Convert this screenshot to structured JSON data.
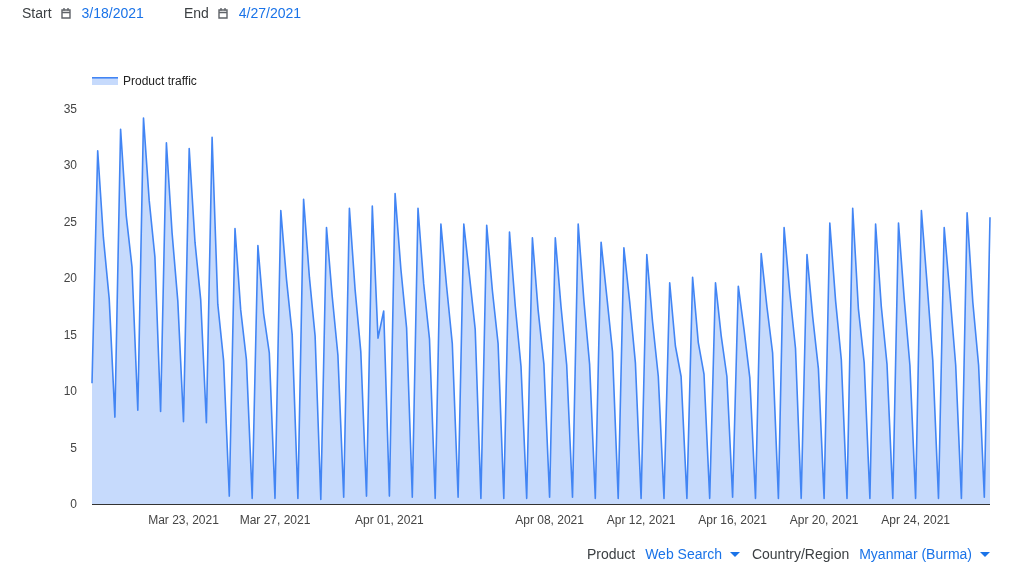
{
  "date_range": {
    "start_label": "Start",
    "start_date": "3/18/2021",
    "end_label": "End",
    "end_date": "4/27/2021"
  },
  "chart": {
    "chart_data": {
      "type": "area",
      "ylim": [
        0,
        35
      ],
      "yticks": [
        0,
        5,
        10,
        15,
        20,
        25,
        30,
        35
      ],
      "categories": [
        null,
        null,
        null,
        null,
        null,
        null,
        null,
        null,
        null,
        null,
        null,
        null,
        null,
        null,
        null,
        null,
        "Mar 23, 2021",
        null,
        null,
        null,
        null,
        null,
        null,
        null,
        null,
        null,
        null,
        null,
        null,
        null,
        null,
        null,
        "Mar 27, 2021",
        null,
        null,
        null,
        null,
        null,
        null,
        null,
        null,
        null,
        null,
        null,
        null,
        null,
        null,
        null,
        null,
        null,
        null,
        null,
        "Apr 01, 2021",
        null,
        null,
        null,
        null,
        null,
        null,
        null,
        null,
        null,
        null,
        null,
        null,
        null,
        null,
        null,
        null,
        null,
        null,
        null,
        null,
        null,
        null,
        null,
        null,
        null,
        null,
        null,
        "Apr 08, 2021",
        null,
        null,
        null,
        null,
        null,
        null,
        null,
        null,
        null,
        null,
        null,
        null,
        null,
        null,
        null,
        "Apr 12, 2021",
        null,
        null,
        null,
        null,
        null,
        null,
        null,
        null,
        null,
        null,
        null,
        null,
        null,
        null,
        null,
        "Apr 16, 2021",
        null,
        null,
        null,
        null,
        null,
        null,
        null,
        null,
        null,
        null,
        null,
        null,
        null,
        null,
        null,
        "Apr 20, 2021",
        null,
        null,
        null,
        null,
        null,
        null,
        null,
        null,
        null,
        null,
        null,
        null,
        null,
        null,
        null,
        "Apr 24, 2021",
        null,
        null,
        null,
        null,
        null,
        null,
        null,
        null,
        null,
        null,
        null,
        null,
        null
      ],
      "series": [
        {
          "name": "Product traffic",
          "color": "#4285f4",
          "values": [
            10.7,
            31.3,
            23.6,
            18.2,
            7.7,
            33.2,
            25.5,
            21.0,
            8.3,
            34.2,
            26.9,
            21.9,
            8.2,
            32.0,
            24.0,
            18.0,
            7.3,
            31.5,
            23.2,
            18.1,
            7.2,
            32.5,
            17.7,
            12.7,
            0.7,
            24.4,
            17.2,
            12.8,
            0.5,
            22.9,
            16.9,
            13.4,
            0.5,
            26.0,
            19.9,
            15.0,
            0.5,
            27.0,
            20.1,
            14.9,
            0.4,
            24.5,
            18.4,
            13.2,
            0.6,
            26.2,
            19.0,
            13.5,
            0.7,
            26.4,
            14.7,
            17.1,
            0.7,
            27.5,
            20.8,
            15.6,
            0.6,
            26.2,
            19.5,
            14.6,
            0.5,
            24.8,
            19.3,
            14.2,
            0.6,
            24.8,
            20.2,
            15.5,
            0.5,
            24.7,
            18.9,
            14.2,
            0.5,
            24.1,
            17.5,
            12.2,
            0.5,
            23.6,
            17.2,
            12.4,
            0.6,
            23.6,
            17.5,
            12.3,
            0.6,
            24.8,
            18.0,
            12.4,
            0.5,
            23.2,
            18.4,
            13.5,
            0.5,
            22.7,
            17.9,
            12.5,
            0.5,
            22.1,
            16.2,
            11.3,
            0.5,
            19.6,
            14.0,
            11.3,
            0.5,
            20.1,
            14.3,
            11.5,
            0.5,
            19.6,
            14.9,
            11.3,
            0.6,
            19.3,
            15.4,
            11.2,
            0.5,
            22.2,
            17.5,
            13.4,
            0.5,
            24.5,
            18.7,
            13.8,
            0.5,
            22.1,
            16.6,
            12.0,
            0.5,
            24.9,
            18.0,
            12.8,
            0.5,
            26.2,
            17.3,
            12.5,
            0.5,
            24.8,
            17.5,
            12.4,
            0.5,
            24.9,
            18.2,
            12.3,
            0.5,
            26.0,
            19.5,
            12.7,
            0.5,
            24.5,
            18.5,
            12.3,
            0.5,
            25.8,
            17.9,
            12.3,
            0.6,
            25.4
          ]
        }
      ]
    }
  },
  "filters": [
    {
      "label": "Product",
      "value": "Web Search"
    },
    {
      "label": "Country/Region",
      "value": "Myanmar (Burma)"
    }
  ]
}
